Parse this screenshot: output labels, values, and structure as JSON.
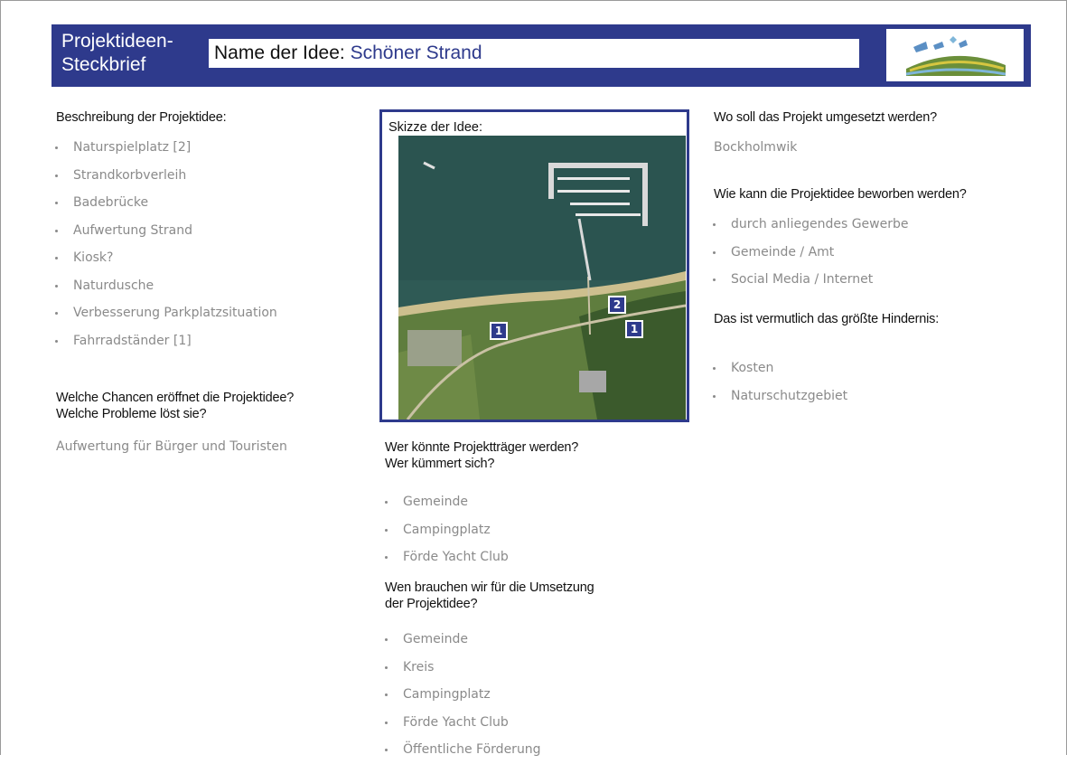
{
  "header": {
    "title_line1": "Projektideen-",
    "title_line2": "Steckbrief",
    "idea_label": "Name der Idee: ",
    "idea_value": "Schöner Strand"
  },
  "description": {
    "heading": "Beschreibung der Projektidee:",
    "items": [
      "Naturspielplatz [2]",
      "Strandkorbverleih",
      "Badebrücke",
      "Aufwertung Strand",
      "Kiosk?",
      "Naturdusche",
      "Verbesserung Parkplatzsituation",
      "Fahrradständer [1]"
    ]
  },
  "chances": {
    "heading_line1": "Welche Chancen eröffnet die Projektidee?",
    "heading_line2": "Welche Probleme löst sie?",
    "text": "Aufwertung für Bürger und Touristen"
  },
  "sketch": {
    "title": "Skizze der Idee:",
    "markers": [
      "1",
      "2",
      "1"
    ]
  },
  "carrier": {
    "heading_line1": "Wer könnte Projektträger werden?",
    "heading_line2": "Wer kümmert sich?",
    "items": [
      "Gemeinde",
      "Campingplatz",
      "Förde Yacht Club"
    ]
  },
  "needs": {
    "heading_line1": "Wen brauchen wir für die Umsetzung",
    "heading_line2": "der Projektidee?",
    "items": [
      "Gemeinde",
      "Kreis",
      "Campingplatz",
      "Förde Yacht Club",
      "Öffentliche Förderung"
    ]
  },
  "location": {
    "heading": "Wo soll das Projekt umgesetzt werden?",
    "text": "Bockholmwik"
  },
  "promotion": {
    "heading": "Wie kann die Projektidee beworben werden?",
    "items": [
      "durch anliegendes Gewerbe",
      "Gemeinde / Amt",
      "Social Media / Internet"
    ]
  },
  "obstacle": {
    "heading": "Das ist vermutlich das größte Hindernis:",
    "items": [
      "Kosten",
      "Naturschutzgebiet"
    ]
  },
  "colors": {
    "header_blue": "#2e3a8c",
    "answer_gray": "#8a8a8a"
  }
}
